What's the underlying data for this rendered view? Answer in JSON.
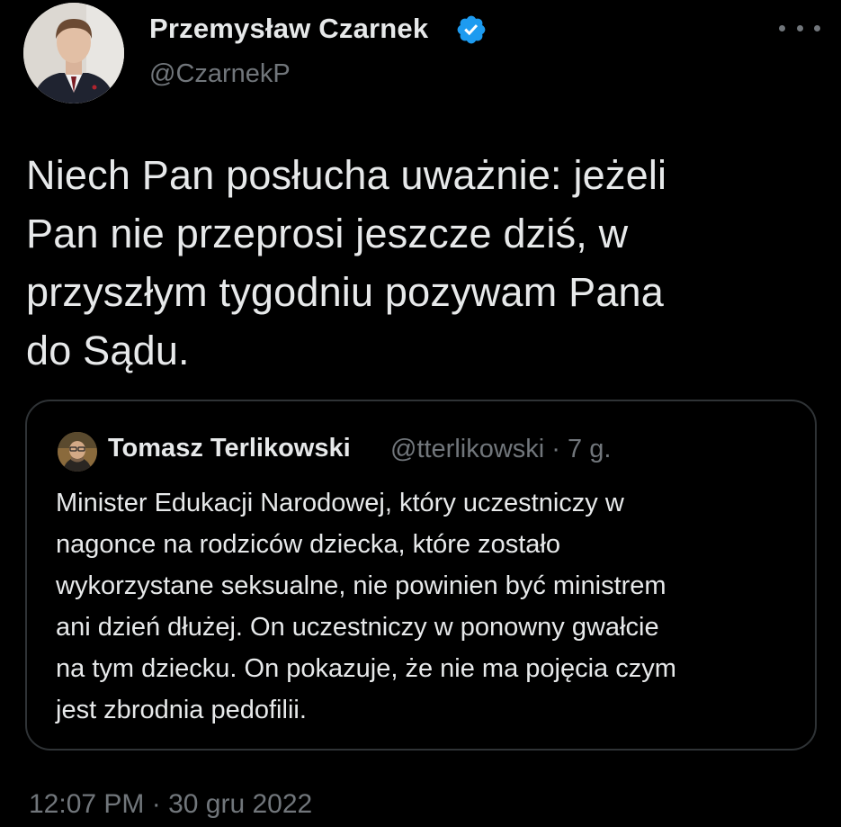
{
  "tweet": {
    "author": {
      "name": "Przemysław Czarnek",
      "handle": "@CzarnekP",
      "verified": true
    },
    "text_lines": [
      "Niech Pan posłucha uważnie: jeżeli",
      "Pan nie przeprosi jeszcze dziś, w",
      "przyszłym tygodniu pozywam Pana",
      "do Sądu."
    ],
    "quoted_tweet": {
      "author_name": "Tomasz Terlikowski",
      "handle_and_time": "@tterlikowski · 7 g.",
      "text_lines": [
        "Minister Edukacji Narodowej, który uczestniczy w",
        "nagonce na rodziców dziecka, które zostało",
        "wykorzystane seksualne, nie powinien być ministrem",
        "ani dzień dłużej. On uczestniczy w ponowny gwałcie",
        "na tym dziecku. On pokazuje, że nie ma pojęcia czym",
        "jest zbrodnia pedofilii."
      ]
    },
    "timestamp": "12:07 PM · 30 gru 2022"
  },
  "colors": {
    "background": "#000000",
    "text_primary": "#e7e9ea",
    "text_secondary": "#71767b",
    "border": "#2f3336",
    "verified_badge": "#1d9bf0"
  },
  "icons": {
    "verified": "verified-badge-icon",
    "more": "more-options-icon"
  }
}
